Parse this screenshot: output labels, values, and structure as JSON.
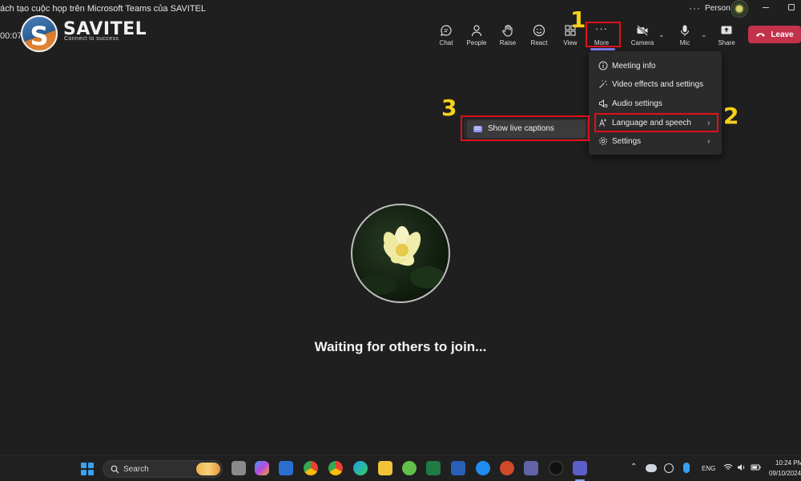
{
  "window": {
    "title": "ách tạo cuộc họp trên Microsoft Teams của SAVITEL",
    "more_dots": "···",
    "profile_label": "Personal"
  },
  "meeting": {
    "timer": "00:07",
    "brand": {
      "name": "SAVITEL",
      "tagline": "Connect to success",
      "letter": "S"
    }
  },
  "toolbar": {
    "chat": "Chat",
    "people": "People",
    "raise": "Raise",
    "react": "React",
    "view": "View",
    "more": "More",
    "more_dots": "···",
    "camera": "Camera",
    "mic": "Mic",
    "share": "Share",
    "leave": "Leave"
  },
  "more_menu": {
    "items": [
      {
        "label": "Meeting info",
        "icon": "info-icon",
        "has_submenu": false
      },
      {
        "label": "Video effects and settings",
        "icon": "video-effects-icon",
        "has_submenu": false
      },
      {
        "label": "Audio settings",
        "icon": "audio-settings-icon",
        "has_submenu": false
      },
      {
        "label": "Language and speech",
        "icon": "language-icon",
        "has_submenu": true
      },
      {
        "label": "Settings",
        "icon": "gear-icon",
        "has_submenu": true
      }
    ]
  },
  "submenu": {
    "item": "Show live captions",
    "icon": "cc-icon",
    "icon_text": "CC"
  },
  "annotations": {
    "step1": "1",
    "step2": "2",
    "step3": "3"
  },
  "stage": {
    "waiting_text": "Waiting for others to join..."
  },
  "taskbar": {
    "search_placeholder": "Search",
    "language": "ENG",
    "time": "10:24 PM",
    "date": "09/10/2024"
  },
  "colors": {
    "accent": "#7f85f5",
    "leave": "#c4314b",
    "highlight": "#e0101a",
    "step_number": "#f6d21b"
  }
}
